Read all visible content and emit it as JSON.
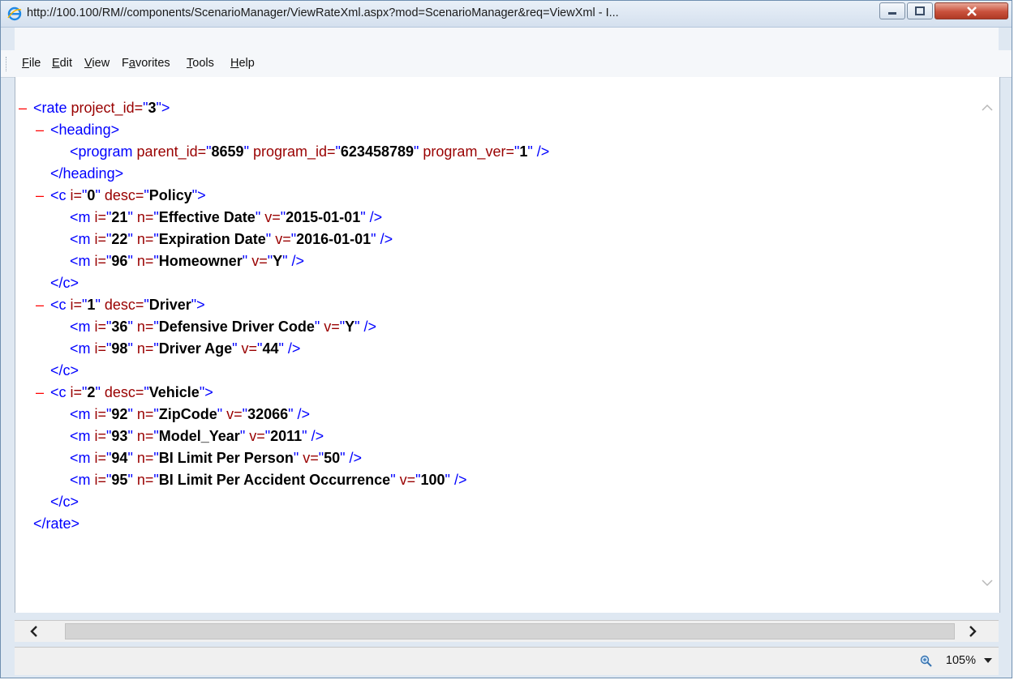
{
  "window": {
    "title": "http://100.100/RM//components/ScenarioManager/ViewRateXml.aspx?mod=ScenarioManager&req=ViewXml - I...",
    "accent": "#6f8fb0"
  },
  "menu": [
    {
      "label": "File",
      "u": "F",
      "rest": "ile"
    },
    {
      "label": "Edit",
      "u": "E",
      "rest": "dit"
    },
    {
      "label": "View",
      "u": "V",
      "rest": "iew"
    },
    {
      "label": "Favorites",
      "pre": "F",
      "u": "a",
      "rest": "vorites"
    },
    {
      "label": "Tools",
      "u": "T",
      "rest": "ools"
    },
    {
      "label": "Help",
      "u": "H",
      "rest": "elp"
    }
  ],
  "xml": {
    "minus": "–",
    "rate_open": {
      "tag": "<rate",
      "attr": " project_id=",
      "val": "3",
      "close": ">"
    },
    "heading_open": "<heading>",
    "program": {
      "tag": "<program",
      "a1": " parent_id=",
      "v1": "8659",
      "a2": " program_id=",
      "v2": "623458789",
      "a3": " program_ver=",
      "v3": "1",
      "end": " />"
    },
    "heading_close": "</heading>",
    "c_close": "</c>",
    "rate_close": "</rate>",
    "groups": [
      {
        "i": "0",
        "desc": "Policy",
        "items": [
          {
            "i": "21",
            "n": "Effective Date",
            "v": "2015-01-01"
          },
          {
            "i": "22",
            "n": "Expiration Date",
            "v": "2016-01-01"
          },
          {
            "i": "96",
            "n": "Homeowner",
            "v": "Y"
          }
        ]
      },
      {
        "i": "1",
        "desc": "Driver",
        "items": [
          {
            "i": "36",
            "n": "Defensive Driver Code",
            "v": "Y"
          },
          {
            "i": "98",
            "n": "Driver Age",
            "v": "44"
          }
        ]
      },
      {
        "i": "2",
        "desc": "Vehicle",
        "items": [
          {
            "i": "92",
            "n": "ZipCode",
            "v": "32066"
          },
          {
            "i": "93",
            "n": "Model_Year",
            "v": "2011"
          },
          {
            "i": "94",
            "n": "BI Limit Per Person",
            "v": "50"
          },
          {
            "i": "95",
            "n": "BI Limit Per Accident Occurrence",
            "v": "100"
          }
        ]
      }
    ]
  },
  "status": {
    "zoom": "105%"
  }
}
